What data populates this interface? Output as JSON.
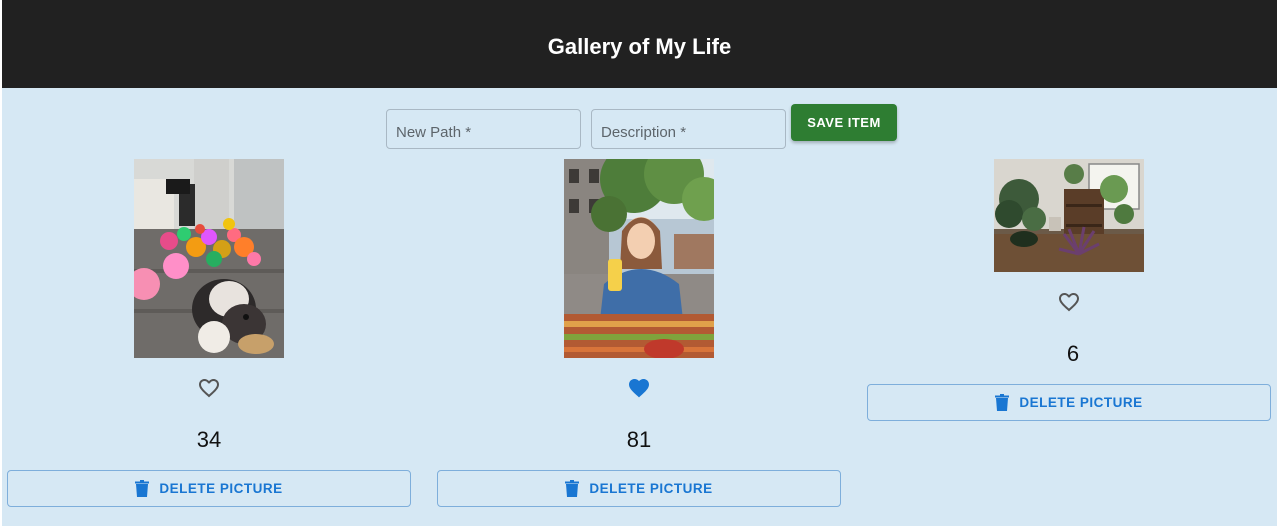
{
  "header": {
    "title": "Gallery of My Life"
  },
  "form": {
    "path_placeholder": "New Path *",
    "description_placeholder": "Description *",
    "save_label": "SAVE ITEM"
  },
  "gallery": {
    "delete_label": "DELETE PICTURE",
    "items": [
      {
        "likes": "34",
        "liked": false,
        "subject": "dog with balloons"
      },
      {
        "likes": "81",
        "liked": true,
        "subject": "woman with drink"
      },
      {
        "likes": "6",
        "liked": false,
        "subject": "house plants"
      }
    ]
  },
  "colors": {
    "header_bg": "#212121",
    "page_bg": "#d6e8f4",
    "save_button": "#2e7d32",
    "accent_blue": "#1976d2"
  },
  "icons": {
    "heart_outline": "heart-outline-icon",
    "heart_filled": "heart-filled-icon",
    "trash": "trash-icon"
  }
}
